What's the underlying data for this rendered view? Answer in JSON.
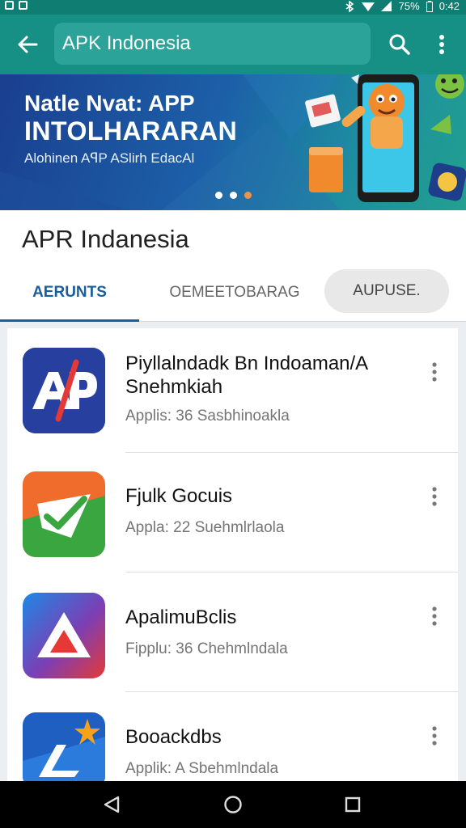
{
  "status_bar": {
    "battery": "75%",
    "time": "0:42"
  },
  "search": {
    "value": "APK Indonesia"
  },
  "banner": {
    "line1": "Natle Nvat: APP",
    "line2": "INTOLHARARAN",
    "line3": "Alohinen AꟼP ASlirh EdacAl",
    "active_dot": 0
  },
  "page": {
    "title": "APR Indanesia"
  },
  "tabs": [
    {
      "label": "AERUNTS"
    },
    {
      "label": "OEMEETOBARAG"
    },
    {
      "label": "AUPUSE."
    }
  ],
  "apps": [
    {
      "title": "Piyllalndadk Bn Indoaman/A",
      "title2": "Snehmkiah",
      "subtitle": "Applis: 36 Sasbhinoakla",
      "icon": "ap-logo-icon"
    },
    {
      "title": "Fjulk Gocuis",
      "title2": "",
      "subtitle": "Appla: 22 Suehmlrlaola",
      "icon": "check-logo-icon"
    },
    {
      "title": "ApalimuBclis",
      "title2": "",
      "subtitle": "Fipplu: 36 Chehmlndala",
      "icon": "triangle-logo-icon"
    },
    {
      "title": "Booackdbs",
      "title2": "",
      "subtitle": "Applik: A Sbehmlndala",
      "icon": "star-logo-icon"
    }
  ],
  "colors": {
    "appbar": "#168f84",
    "accent": "#1b5e9c"
  }
}
